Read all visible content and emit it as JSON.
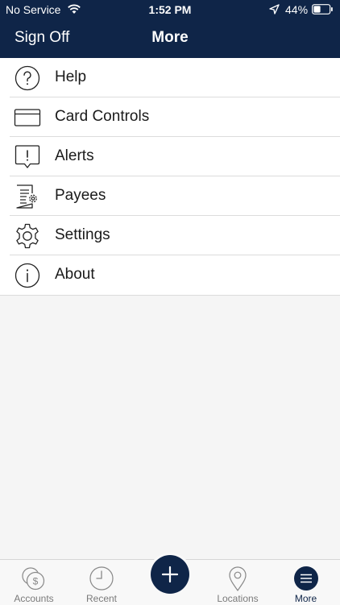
{
  "status_bar": {
    "carrier": "No Service",
    "time": "1:52 PM",
    "battery_pct": "44%",
    "battery_level": 0.44
  },
  "nav": {
    "left_label": "Sign Off",
    "title": "More"
  },
  "menu": {
    "items": [
      {
        "label": "Help",
        "icon": "help-icon"
      },
      {
        "label": "Card Controls",
        "icon": "card-icon"
      },
      {
        "label": "Alerts",
        "icon": "alert-icon"
      },
      {
        "label": "Payees",
        "icon": "payees-icon"
      },
      {
        "label": "Settings",
        "icon": "gear-icon"
      },
      {
        "label": "About",
        "icon": "info-icon"
      }
    ]
  },
  "tabbar": {
    "tabs": [
      {
        "label": "Accounts",
        "icon": "accounts-icon"
      },
      {
        "label": "Recent",
        "icon": "clock-icon"
      },
      {
        "label": "Locations",
        "icon": "location-pin-icon"
      },
      {
        "label": "More",
        "icon": "menu-icon",
        "active": true
      }
    ],
    "center_action_icon": "plus-icon"
  },
  "colors": {
    "navy": "#0f2548",
    "background": "#f5f5f5",
    "divider": "#dcdcdc",
    "tab_inactive": "#7a7a7a"
  }
}
